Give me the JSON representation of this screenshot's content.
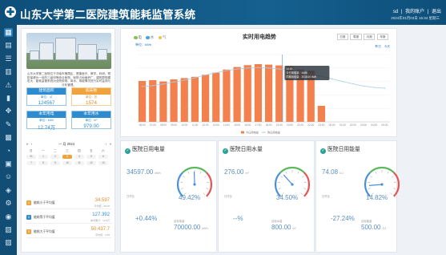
{
  "header": {
    "title": "山东大学第二医院建筑能耗监管系统",
    "links": [
      "sd",
      "我的账户",
      "退出"
    ],
    "date": "2024年01月03日 16:34 星期三"
  },
  "sidebar": {
    "icons": [
      "grid-icon",
      "calendar-icon",
      "list-icon",
      "chart-icon",
      "alert-icon",
      "battery-icon",
      "move-icon",
      "edit-icon",
      "stats-icon",
      "meter-icon",
      "building-icon",
      "user-icon",
      "map-icon",
      "gear-icon",
      "camera-icon",
      "document-icon",
      "report-icon"
    ]
  },
  "intro": {
    "text": "山东大学第二医院位于济南市槐荫区，是集医疗、教学、科研、预防保健为一体的三级甲等综合医院。医院占地面积广，建筑群规模宏大，能耗监管系统对全院用电、用水、用能情况进行实时监测与分析管理。",
    "stats": [
      {
        "label": "建筑面积",
        "unit": "单位：㎡",
        "value": "124567",
        "color": "#2d8ccf"
      },
      {
        "label": "病床数",
        "unit": "单位：张",
        "value": "1574",
        "color": "#f0a33c"
      },
      {
        "label": "本年用电",
        "unit": "单位：kWh",
        "value": "12.74万",
        "color": "#2d8ccf"
      },
      {
        "label": "本年用水",
        "unit": "单位：m³",
        "value": "979.00",
        "color": "#2d8ccf"
      }
    ]
  },
  "calendar": {
    "title": "一 月 2024",
    "weekdays": [
      "日",
      "一",
      "二",
      "三",
      "四",
      "五",
      "六"
    ],
    "days": [
      "31",
      "1",
      "2",
      "3",
      "4",
      "5",
      "6",
      "7",
      "8",
      "9",
      "10",
      "11",
      "12",
      "13"
    ],
    "selected": "3"
  },
  "mini_list": [
    {
      "badge": "1",
      "label": "能耗小于平均值",
      "value": "34.597",
      "sub": "平均值：39.00",
      "color": "#f0a33c",
      "text_color": "#e08a2a"
    },
    {
      "badge": "2",
      "label": "能耗等于平均值",
      "value": "127.392",
      "sub": "本月累计：12.9万",
      "color": "#2d8ccf",
      "text_color": "#2d8ccf"
    },
    {
      "badge": "3",
      "label": "能耗大于平均值",
      "value": "50.437.7",
      "sub": "平均值：0.55",
      "color": "#f0a33c",
      "text_color": "#e08a2a"
    }
  ],
  "chart_panel": {
    "title": "实时用电趋势",
    "toggles": [
      "电",
      "水",
      "气"
    ],
    "unit": "单位：kWh",
    "range_buttons": [
      "日报",
      "周报",
      "月报",
      "年报"
    ],
    "compare_link": "昨日",
    "compare_link2": "今天",
    "tooltip": {
      "time": "14:00",
      "line1": "今日用电量：4486",
      "line2": "同期用电量：2018.00 kWh"
    },
    "legend": [
      "今日用电量",
      "昨日用电量"
    ]
  },
  "chart_data": {
    "type": "bar",
    "categories": [
      "06:00",
      "07:00",
      "08:00",
      "09:00",
      "10:00",
      "11:00",
      "12:00",
      "13:00",
      "14:00",
      "15:00",
      "16:00",
      "17:00",
      "18:00",
      "19:00",
      "20:00",
      "21:00",
      "22:00",
      "23:00",
      "00:00",
      "01:00",
      "02:00",
      "03:00",
      "04:00",
      "05:00"
    ],
    "series": [
      {
        "name": "今日用电量",
        "values": [
          1580,
          1610,
          1560,
          1640,
          1690,
          1740,
          1820,
          1900,
          2020,
          2120,
          2190,
          2230,
          2210,
          2180,
          2140,
          2020,
          1980,
          620,
          0,
          0,
          0,
          0,
          0,
          0
        ],
        "color": "#f4804d"
      },
      {
        "name": "昨日用电量",
        "values": [
          1360,
          1400,
          1460,
          1540,
          1610,
          1700,
          1810,
          1900,
          1980,
          2040,
          2080,
          2100,
          2080,
          2040,
          1990,
          1920,
          1850,
          1760,
          1660,
          1560,
          1470,
          1380,
          1330,
          1300
        ],
        "color": "#a8cce8"
      }
    ],
    "ylim": [
      0,
      2600
    ]
  },
  "metrics": [
    {
      "title": "医院日用电量",
      "value": "34597.00",
      "unit": "kWh",
      "gauge_pct": "49.42%",
      "gauge_fill": 0.4942,
      "ratio": "+0.44%",
      "ratio_label": "日环比",
      "yest_label": "昨日电量",
      "target_label": "目标电量",
      "target": "70000.00",
      "target_unit": "kWh",
      "color": "#2aa198"
    },
    {
      "title": "医院日用水量",
      "value": "276.00",
      "unit": "m³",
      "gauge_pct": "34.50%",
      "gauge_fill": 0.345,
      "ratio": "--%",
      "ratio_label": "日环比",
      "yest_label": "昨日水量",
      "target_label": "目标水量",
      "target": "800.00",
      "target_unit": "m³",
      "color": "#2aa198"
    },
    {
      "title": "医院日用能量",
      "value": "74.08",
      "unit": "GJ",
      "gauge_pct": "14.82%",
      "gauge_fill": 0.1482,
      "ratio": "-27.24%",
      "ratio_label": "日环比",
      "yest_label": "昨日能量",
      "target_label": "目标能量",
      "target": "500.00",
      "target_unit": "GJ",
      "color": "#2aa198"
    }
  ]
}
